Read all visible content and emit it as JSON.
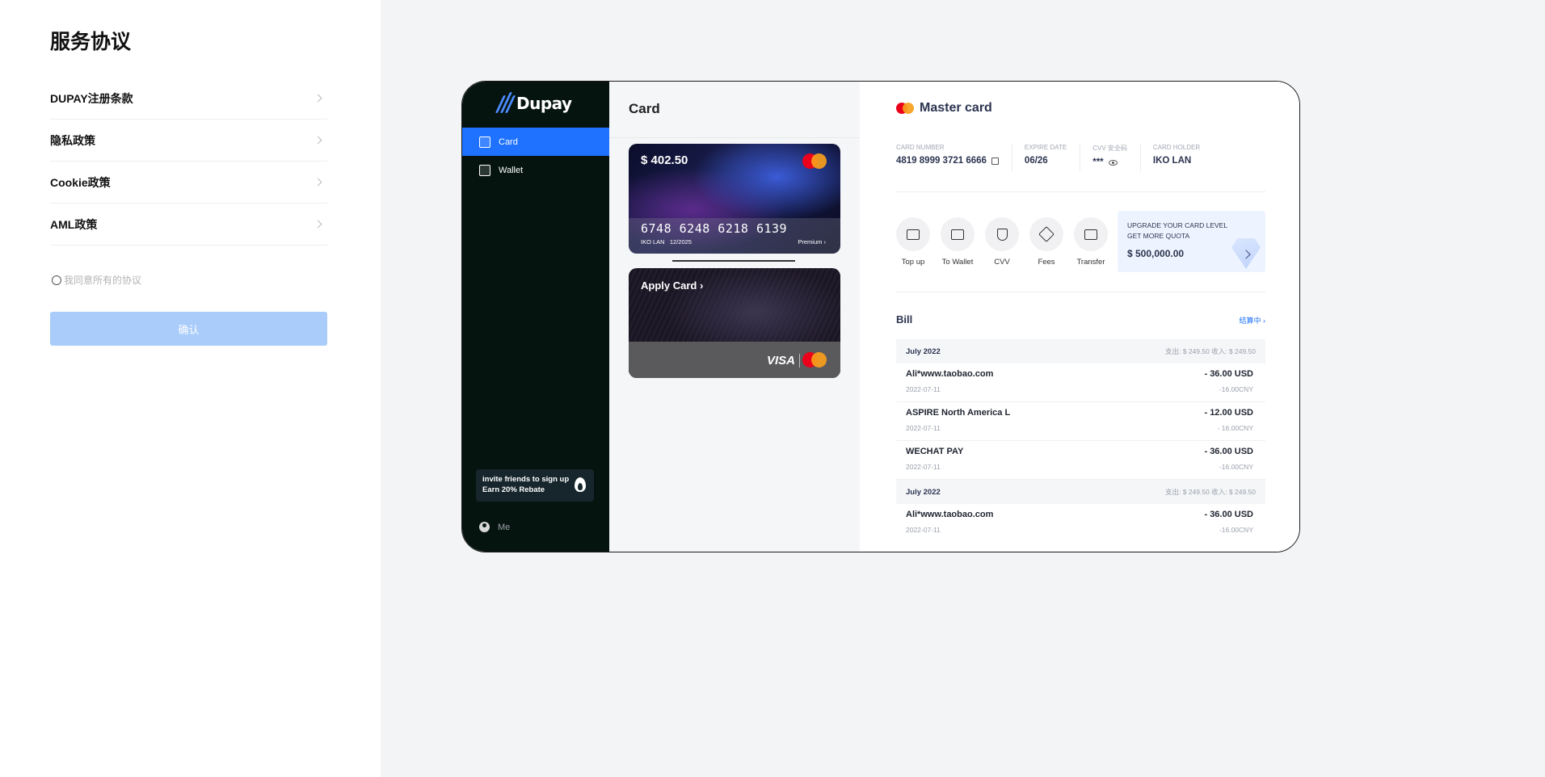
{
  "agreement": {
    "title": "服务协议",
    "items": [
      {
        "label": "DUPAY注册条款"
      },
      {
        "label": "隐私政策"
      },
      {
        "label": "Cookie政策"
      },
      {
        "label": "AML政策"
      }
    ],
    "agree_label": "我同意所有的协议",
    "confirm_label": "确认"
  },
  "app": {
    "logo_text": "Dupay",
    "nav": [
      {
        "label": "Card",
        "icon": "card-icon",
        "active": true
      },
      {
        "label": "Wallet",
        "icon": "wallet-icon",
        "active": false
      }
    ],
    "invite_line1": "invite friends to sign up",
    "invite_line2": "Earn 20% Rebate",
    "me_label": "Me",
    "card_column_title": "Card",
    "card1": {
      "balance": "$ 402.50",
      "number": "6748 6248 6218 6139",
      "holder": "IKO LAN",
      "expiry": "12/2025",
      "tier": "Premium"
    },
    "card2": {
      "apply_label": "Apply Card",
      "visa_label": "VISA"
    }
  },
  "detail": {
    "title": "Master card",
    "fields": [
      {
        "label": "CARD NUMBER",
        "value": "4819 8999 3721 6666"
      },
      {
        "label": "EXPIRE DATE",
        "value": "06/26"
      },
      {
        "label": "CVV 安全码",
        "value": "***"
      },
      {
        "label": "CARD HOLDER",
        "value": "IKO LAN"
      }
    ],
    "actions": [
      {
        "label": "Top up"
      },
      {
        "label": "To Wallet"
      },
      {
        "label": "CVV"
      },
      {
        "label": "Fees"
      },
      {
        "label": "Transfer"
      }
    ],
    "upgrade": {
      "line1": "UPGRADE YOUR CARD LEVEL",
      "line2": "GET MORE QUOTA",
      "amount": "$ 500,000.00"
    },
    "bill_title": "Bill",
    "bill_link": "结算中",
    "months": [
      {
        "month": "July 2022",
        "summary": "支出: $ 249.50   收入: $ 249.50",
        "transactions": [
          {
            "name": "Ali*www.taobao.com",
            "date": "2022-07-11",
            "amount": "- 36.00 USD",
            "cny": "-16.00CNY"
          },
          {
            "name": "ASPIRE North America L",
            "date": "2022-07-11",
            "amount": "- 12.00 USD",
            "cny": "- 16.00CNY"
          },
          {
            "name": "WECHAT PAY",
            "date": "2022-07-11",
            "amount": "- 36.00 USD",
            "cny": "-16.00CNY"
          }
        ]
      },
      {
        "month": "July 2022",
        "summary": "支出: $ 249.50   收入: $ 249.50",
        "transactions": [
          {
            "name": "Ali*www.taobao.com",
            "date": "2022-07-11",
            "amount": "- 36.00 USD",
            "cny": "-16.00CNY"
          }
        ]
      }
    ]
  },
  "colors": {
    "accent": "#1e72ff",
    "sidebar": "#06140f",
    "confirm_disabled": "#a9ccfb"
  }
}
